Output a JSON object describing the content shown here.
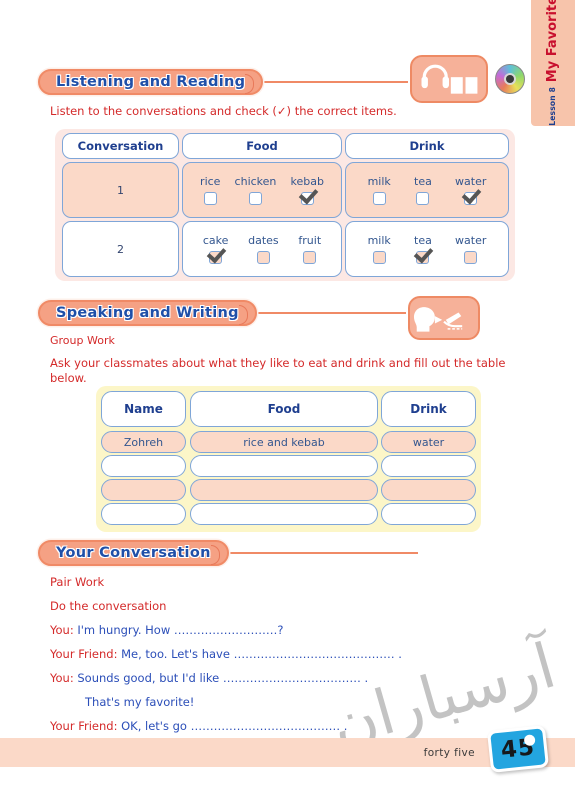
{
  "side_tab": {
    "lesson_number": "Lesson 8",
    "lesson_title": "My Favorite Food"
  },
  "sections": {
    "listening": {
      "heading": "Listening and Reading",
      "instruction": "Listen to the conversations and check (✓) the correct items.",
      "icons": [
        "headphones-book-icon",
        "cd-icon"
      ],
      "table": {
        "headers": [
          "Conversation",
          "Food",
          "Drink"
        ],
        "rows": [
          {
            "number": "1",
            "food": [
              {
                "label": "rice",
                "checked": false
              },
              {
                "label": "chicken",
                "checked": false
              },
              {
                "label": "kebab",
                "checked": true
              }
            ],
            "drink": [
              {
                "label": "milk",
                "checked": false
              },
              {
                "label": "tea",
                "checked": false
              },
              {
                "label": "water",
                "checked": true
              }
            ]
          },
          {
            "number": "2",
            "food": [
              {
                "label": "cake",
                "checked": true
              },
              {
                "label": "dates",
                "checked": false
              },
              {
                "label": "fruit",
                "checked": false
              }
            ],
            "drink": [
              {
                "label": "milk",
                "checked": false
              },
              {
                "label": "tea",
                "checked": true
              },
              {
                "label": "water",
                "checked": false
              }
            ]
          }
        ]
      }
    },
    "speaking": {
      "heading": "Speaking and Writing",
      "sub_label": "Group Work",
      "instruction": "Ask your classmates about what they like to eat and drink and fill out the table below.",
      "icon": "speaking-writing-icon",
      "table": {
        "headers": [
          "Name",
          "Food",
          "Drink"
        ],
        "rows": [
          {
            "name": "Zohreh",
            "food": "rice and kebab",
            "drink": "water"
          },
          {
            "name": "",
            "food": "",
            "drink": ""
          },
          {
            "name": "",
            "food": "",
            "drink": ""
          },
          {
            "name": "",
            "food": "",
            "drink": ""
          }
        ]
      }
    },
    "conversation": {
      "heading": "Your Conversation",
      "sub_label": "Pair Work",
      "instruction": "Do the conversation",
      "lines": [
        {
          "speaker": "You:",
          "text": "I'm hungry. How ………………………?"
        },
        {
          "speaker": "Your Friend:",
          "text": "Me, too. Let's have …………………………………… ."
        },
        {
          "speaker": "You:",
          "text": "Sounds good, but I'd like ……………………………… ."
        },
        {
          "speaker": "",
          "text": "That's my favorite!"
        },
        {
          "speaker": "Your Friend:",
          "text": "OK, let's go ………………………………… ."
        }
      ]
    }
  },
  "footer": {
    "folio_word": "forty five",
    "page_number": "45"
  },
  "watermark": "آرسباران",
  "colors": {
    "accent_peach": "#f5a184",
    "heading_blue": "#1f4fa8",
    "instruction_red": "#d42a2a",
    "dialog_blue": "#2b4eb8",
    "table_border_blue": "#7fa6d8",
    "cell_peach": "#fbd9c8",
    "panel_pink": "#fce8e4",
    "panel_yellow": "#fcf6c8",
    "folio_blue": "#23a5e0",
    "side_tab": "#f7c4ab"
  }
}
